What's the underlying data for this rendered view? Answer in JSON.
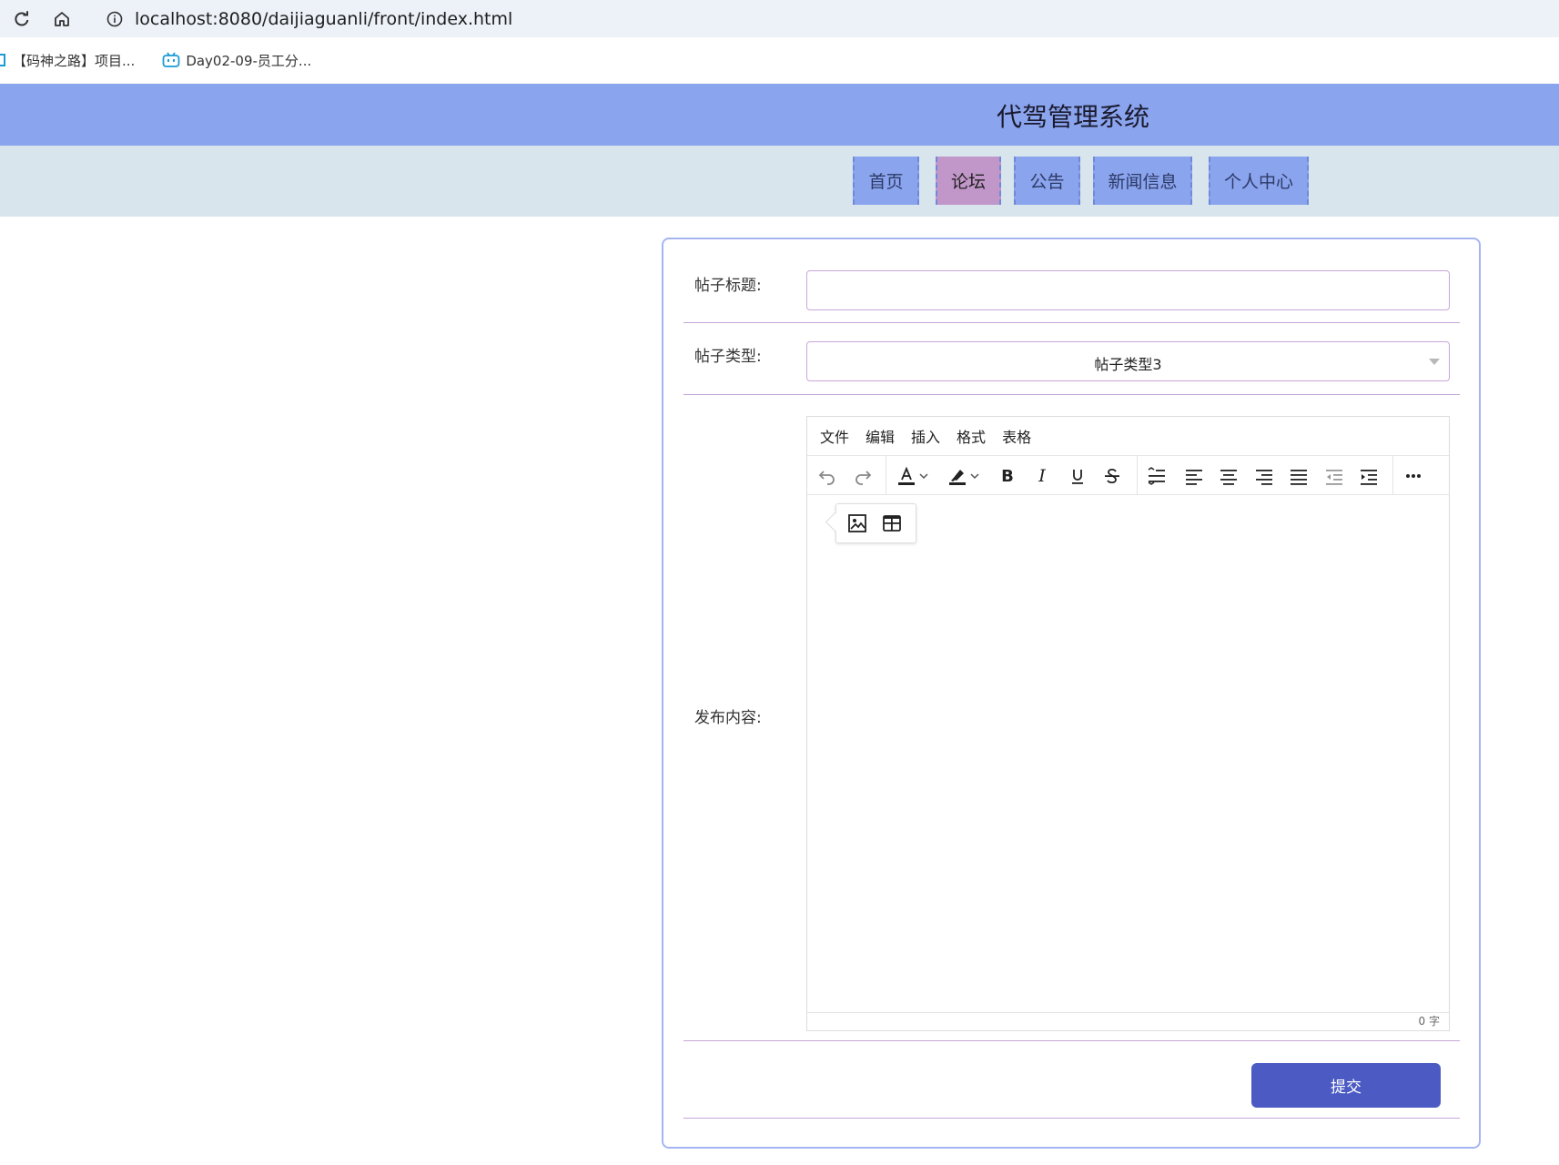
{
  "browser": {
    "url": "localhost:8080/daijiaguanli/front/index.html",
    "bookmarks": [
      {
        "label": "【码神之路】项目...",
        "icon": "bookmark-icon"
      },
      {
        "label": "Day02-09-员工分...",
        "icon": "bilibili-icon"
      }
    ]
  },
  "app": {
    "title": "代驾管理系统",
    "nav": [
      {
        "label": "首页",
        "active": false
      },
      {
        "label": "论坛",
        "active": true
      },
      {
        "label": "公告",
        "active": false
      },
      {
        "label": "新闻信息",
        "active": false
      },
      {
        "label": "个人中心",
        "active": false
      }
    ]
  },
  "form": {
    "title_label": "帖子标题:",
    "title_value": "",
    "type_label": "帖子类型:",
    "type_value": "帖子类型3",
    "content_label": "发布内容:",
    "submit_label": "提交"
  },
  "editor": {
    "menus": [
      "文件",
      "编辑",
      "插入",
      "格式",
      "表格"
    ],
    "toolbar_icons": [
      "undo-icon",
      "redo-icon",
      "font-color-icon",
      "highlight-color-icon",
      "bold-icon",
      "italic-icon",
      "underline-icon",
      "strikethrough-icon",
      "line-height-icon",
      "align-left-icon",
      "align-center-icon",
      "align-right-icon",
      "align-justify-icon",
      "outdent-icon",
      "indent-icon",
      "more-icon"
    ],
    "quickbar_icons": [
      "image-icon",
      "table-icon"
    ],
    "word_count": "0 字"
  },
  "colors": {
    "header": "#8ba4ee",
    "navbar": "#d8e5ec",
    "nav_active": "#c196c8",
    "submit": "#4c5bc3"
  }
}
